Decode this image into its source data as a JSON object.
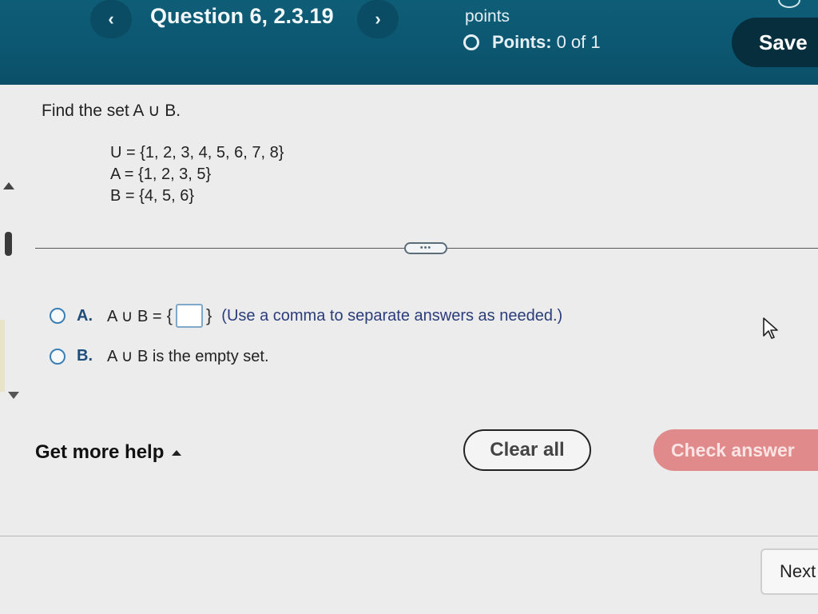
{
  "header": {
    "prev_label": "‹",
    "next_label": "›",
    "title": "Question 6, 2.3.19",
    "points_word": "points",
    "points_label": "Points:",
    "points_value": "0 of 1",
    "save_label": "Save"
  },
  "question": {
    "prompt": "Find the set A ∪ B.",
    "sets": [
      "U = {1, 2, 3, 4, 5, 6, 7, 8}",
      "A = {1, 2, 3, 5}",
      "B = {4, 5, 6}"
    ],
    "expand_label": "•••"
  },
  "options": [
    {
      "letter": "A.",
      "text": "A ∪ B =",
      "brace_open": "{",
      "brace_close": "}",
      "answer_value": "",
      "hint": "(Use a comma to separate answers as needed.)"
    },
    {
      "letter": "B.",
      "text": "A ∪ B is the empty set."
    }
  ],
  "footer": {
    "help_label": "Get more help",
    "clear_label": "Clear all",
    "check_label": "Check answer",
    "next_label": "Next"
  },
  "colors": {
    "header_bg": "#0c5670",
    "save_bg": "#072e3c",
    "check_bg": "#e18a8c",
    "radio_border": "#3a7fb5"
  }
}
